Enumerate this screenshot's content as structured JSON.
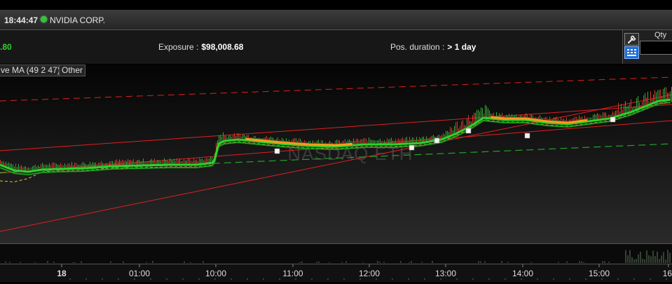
{
  "window": {
    "time": "18:44:47",
    "instrument": "NVIDIA CORP."
  },
  "info_bar": {
    "pnl_value": ".80",
    "exposure_label": "Exposure :",
    "exposure_value": "$98,008.68",
    "pos_duration_label": "Pos. duration :",
    "pos_duration_value": "> 1 day"
  },
  "side_panel": {
    "qty_label": "Qty",
    "qty_value": "",
    "wrench_icon": "wrench-icon",
    "keypad_icon": "keypad-icon"
  },
  "indicator_tabs": {
    "ma_label": "ve MA (49 2 47)",
    "other_label": "Other"
  },
  "chart": {
    "watermark": "NASDAQ ETH",
    "time_ticks": [
      "18",
      "01:00",
      "10:00",
      "11:00",
      "12:00",
      "13:00",
      "14:00",
      "15:00",
      "16"
    ],
    "colors": {
      "background_top": "#050505",
      "background_bottom": "#2a2a2a",
      "price_ma_fast": "#2fd12f",
      "price_ma_slow": "#1f9a1f",
      "highlight_band": "#ff9a1a",
      "trend_red": "#e02020",
      "trend_green_dashed": "#22a52a",
      "signal_dashed": "#e6c220"
    }
  }
}
